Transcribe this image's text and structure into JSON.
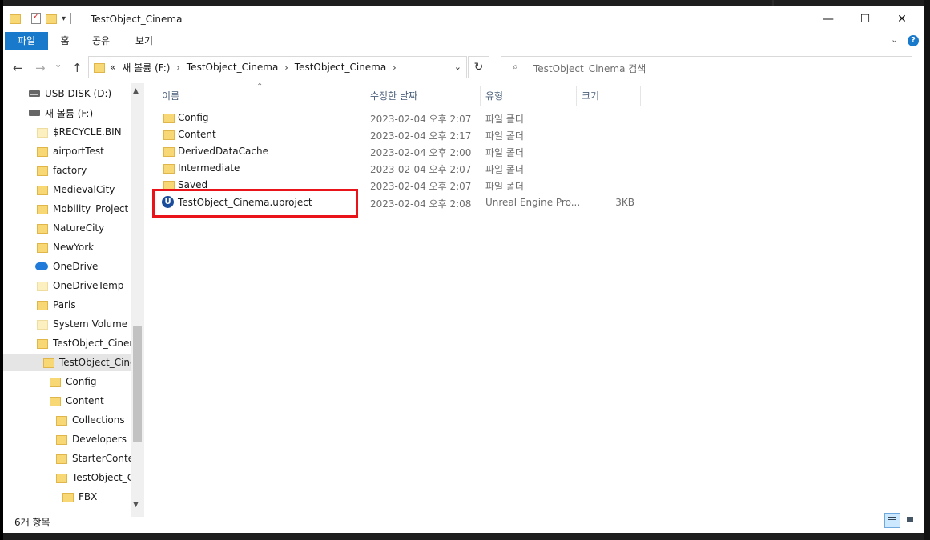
{
  "window": {
    "title": "TestObject_Cinema"
  },
  "titlebar": {
    "minimize": "—",
    "maximize": "☐",
    "close": "✕"
  },
  "ribbon": {
    "tabs": [
      "파일",
      "홈",
      "공유",
      "보기"
    ]
  },
  "nav": {
    "back": "←",
    "forward": "→",
    "recent": "⌄",
    "up": "↑"
  },
  "address": {
    "overflow": "«",
    "crumbs": [
      "새 볼륨 (F:)",
      "TestObject_Cinema",
      "TestObject_Cinema"
    ],
    "refresh": "↻"
  },
  "search": {
    "placeholder": "TestObject_Cinema 검색"
  },
  "tree": {
    "items": [
      {
        "label": "USB DISK (D:)",
        "icon": "drive-icon"
      },
      {
        "label": "새 볼륨 (F:)",
        "icon": "drive-icon"
      },
      {
        "label": "$RECYCLE.BIN",
        "icon": "folder-icon"
      },
      {
        "label": "airportTest",
        "icon": "folder-icon"
      },
      {
        "label": "factory",
        "icon": "folder-icon"
      },
      {
        "label": "MedievalCity",
        "icon": "folder-icon"
      },
      {
        "label": "Mobility_Project_U",
        "icon": "folder-icon"
      },
      {
        "label": "NatureCity",
        "icon": "folder-icon"
      },
      {
        "label": "NewYork",
        "icon": "folder-icon"
      },
      {
        "label": "OneDrive",
        "icon": "cloud-icon"
      },
      {
        "label": "OneDriveTemp",
        "icon": "folder-icon"
      },
      {
        "label": "Paris",
        "icon": "folder-icon"
      },
      {
        "label": "System Volume In",
        "icon": "folder-icon"
      },
      {
        "label": "TestObject_Cinema",
        "icon": "folder-icon"
      },
      {
        "label": "TestObject_Ciner",
        "icon": "folder-icon",
        "selected": true
      },
      {
        "label": "Config",
        "icon": "folder-icon"
      },
      {
        "label": "Content",
        "icon": "folder-icon"
      },
      {
        "label": "Collections",
        "icon": "folder-icon"
      },
      {
        "label": "Developers",
        "icon": "folder-icon"
      },
      {
        "label": "StarterConten",
        "icon": "folder-icon"
      },
      {
        "label": "TestObject_Cir",
        "icon": "folder-icon"
      },
      {
        "label": "FBX",
        "icon": "folder-icon"
      }
    ]
  },
  "columns": {
    "name": "이름",
    "modified": "수정한 날짜",
    "type": "유형",
    "size": "크기"
  },
  "files": [
    {
      "name": "Config",
      "date": "2023-02-04 오후 2:07",
      "type": "파일 폴더",
      "size": ""
    },
    {
      "name": "Content",
      "date": "2023-02-04 오후 2:17",
      "type": "파일 폴더",
      "size": ""
    },
    {
      "name": "DerivedDataCache",
      "date": "2023-02-04 오후 2:00",
      "type": "파일 폴더",
      "size": ""
    },
    {
      "name": "Intermediate",
      "date": "2023-02-04 오후 2:07",
      "type": "파일 폴더",
      "size": ""
    },
    {
      "name": "Saved",
      "date": "2023-02-04 오후 2:07",
      "type": "파일 폴더",
      "size": ""
    },
    {
      "name": "TestObject_Cinema.uproject",
      "date": "2023-02-04 오후 2:08",
      "type": "Unreal Engine Pro...",
      "size": "3KB"
    }
  ],
  "status": {
    "count": "6개 항목"
  },
  "colors": {
    "accent": "#1979ca",
    "highlight": "#e8141a",
    "folder": "#f8d775",
    "selected": "#cce8ff"
  }
}
